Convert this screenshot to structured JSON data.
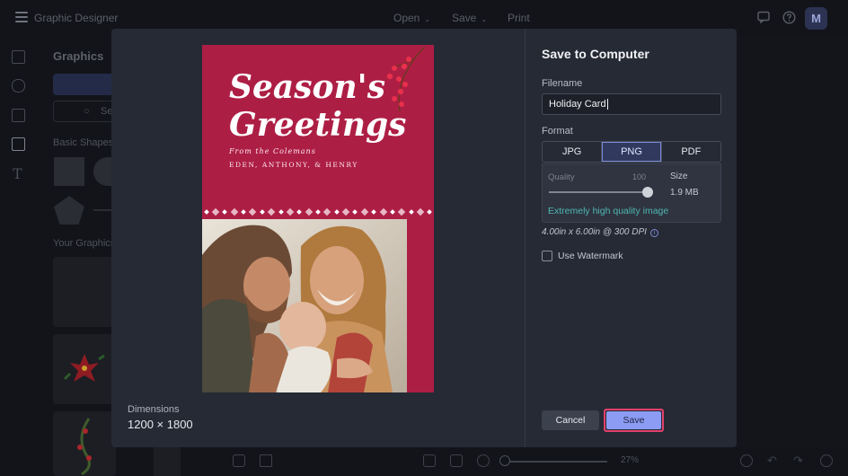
{
  "app": {
    "title": "Graphic Designer",
    "menu": [
      {
        "label": "Open",
        "chevron": "⌄"
      },
      {
        "label": "Save",
        "chevron": "⌄"
      },
      {
        "label": "Print"
      }
    ],
    "avatar_initial": "M",
    "icons": [
      "menu-icon",
      "comment-icon",
      "help-icon"
    ]
  },
  "sidebar": {
    "title": "Graphics",
    "search_placeholder": "Se",
    "sections": [
      "Basic Shapes",
      "Your Graphics"
    ]
  },
  "bottombar": {
    "zoom": "27%"
  },
  "dialog": {
    "title": "Save to Computer",
    "filename_label": "Filename",
    "filename_value": "Holiday Card",
    "format_label": "Format",
    "formats": [
      "JPG",
      "PNG",
      "PDF"
    ],
    "selected_format": "PNG",
    "quality_label": "Quality",
    "quality_value": "100",
    "size_label": "Size",
    "size_value": "1.9 MB",
    "quality_note": "Extremely high quality image",
    "dpi_text": "4.00in x 6.00in @ 300 DPI",
    "watermark_label": "Use Watermark",
    "watermark_checked": false,
    "cancel_label": "Cancel",
    "save_label": "Save",
    "dimensions_label": "Dimensions",
    "dimensions_value": "1200 × 1800"
  },
  "card": {
    "title_line1": "Season's",
    "title_line2": "Greetings",
    "from": "From the Colemans",
    "names": "EDEN, ANTHONY, & HENRY"
  },
  "colors": {
    "card_red": "#ad1e45",
    "accent": "#8c9cf4",
    "save_highlight": "#e2416d",
    "note_teal": "#4fb6b1"
  }
}
